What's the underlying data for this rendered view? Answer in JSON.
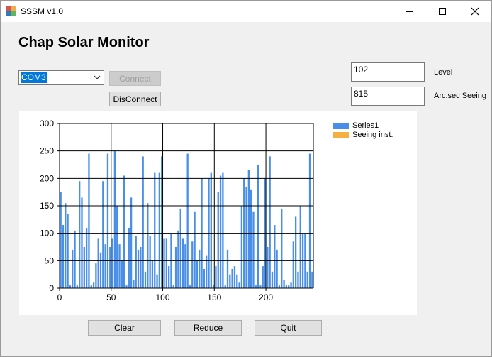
{
  "window": {
    "title": "SSSM v1.0"
  },
  "heading": "Chap Solar Monitor",
  "port_select": {
    "value": "COM3"
  },
  "buttons": {
    "connect": "Connect",
    "disconnect": "DisConnect",
    "clear": "Clear",
    "reduce": "Reduce",
    "quit": "Quit"
  },
  "readouts": {
    "level_value": "102",
    "level_label": "Level",
    "seeing_value": "815",
    "seeing_label": "Arc.sec Seeing"
  },
  "colors": {
    "series1": "#4a8fe7",
    "seeing": "#f5b041",
    "grid": "#000000"
  },
  "chart_data": {
    "type": "bar",
    "xlim": [
      0,
      246
    ],
    "ylim": [
      0,
      300
    ],
    "xticks": [
      0,
      50,
      100,
      150,
      200
    ],
    "yticks": [
      0,
      50,
      100,
      150,
      200,
      250,
      300
    ],
    "grid": true,
    "legend_position": "top-right",
    "series": [
      {
        "name": "Series1",
        "values": [
          175,
          115,
          155,
          135,
          5,
          70,
          105,
          5,
          195,
          165,
          75,
          110,
          245,
          5,
          10,
          45,
          90,
          65,
          195,
          80,
          245,
          75,
          90,
          250,
          150,
          80,
          50,
          205,
          5,
          110,
          165,
          15,
          95,
          70,
          75,
          240,
          30,
          155,
          95,
          50,
          210,
          25,
          210,
          240,
          90,
          90,
          40,
          100,
          5,
          75,
          105,
          145,
          90,
          80,
          245,
          5,
          85,
          140,
          50,
          70,
          200,
          35,
          60,
          200,
          210,
          5,
          40,
          175,
          205,
          210,
          5,
          70,
          25,
          35,
          40,
          25,
          10,
          150,
          200,
          185,
          215,
          180,
          140,
          5,
          225,
          5,
          40,
          200,
          75,
          240,
          30,
          115,
          70,
          5,
          145,
          15,
          5,
          5,
          10,
          85,
          130,
          30,
          150,
          100,
          100,
          30,
          245,
          30
        ]
      },
      {
        "name": "Seeing inst.",
        "values": []
      }
    ]
  }
}
